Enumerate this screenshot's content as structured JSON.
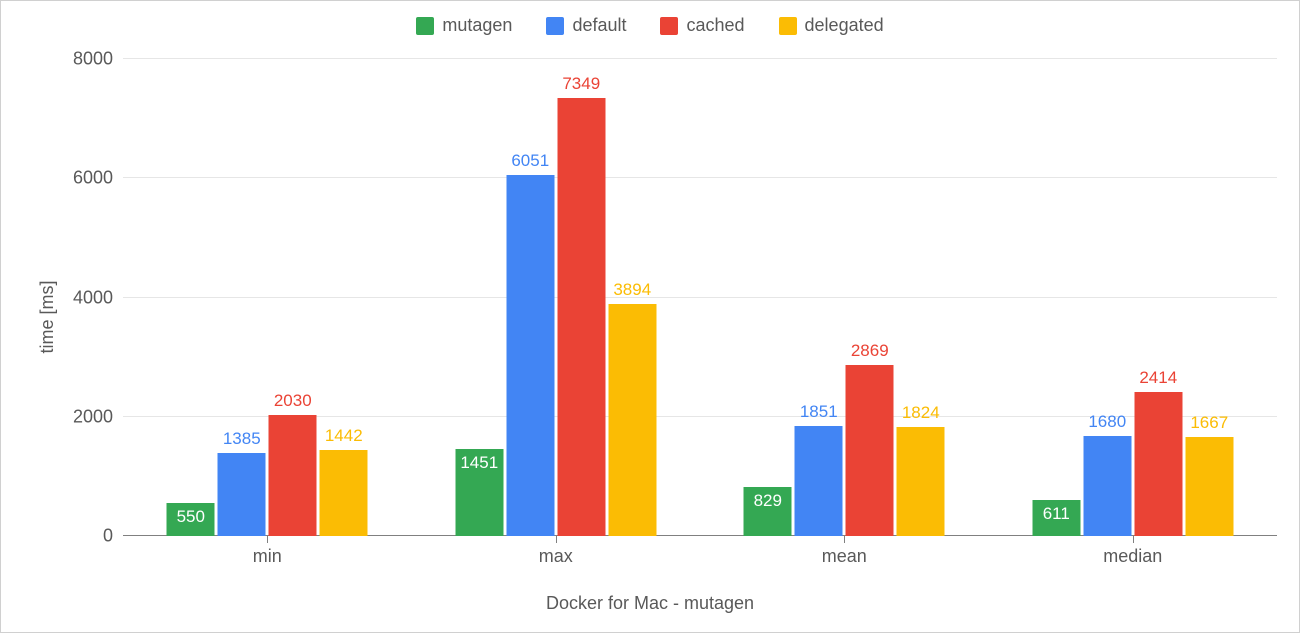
{
  "chart_data": {
    "type": "bar",
    "title": "",
    "xlabel": "Docker for Mac - mutagen",
    "ylabel": "time [ms]",
    "ylim": [
      0,
      8000
    ],
    "yticks": [
      0,
      2000,
      4000,
      6000,
      8000
    ],
    "categories": [
      "min",
      "max",
      "mean",
      "median"
    ],
    "series": [
      {
        "name": "mutagen",
        "color": "#34a853",
        "values": [
          550,
          1451,
          829,
          611
        ]
      },
      {
        "name": "default",
        "color": "#4285f4",
        "values": [
          1385,
          6051,
          1851,
          1680
        ]
      },
      {
        "name": "cached",
        "color": "#ea4335",
        "values": [
          2030,
          7349,
          2869,
          2414
        ]
      },
      {
        "name": "delegated",
        "color": "#fbbc04",
        "values": [
          1442,
          3894,
          1824,
          1667
        ]
      }
    ]
  }
}
